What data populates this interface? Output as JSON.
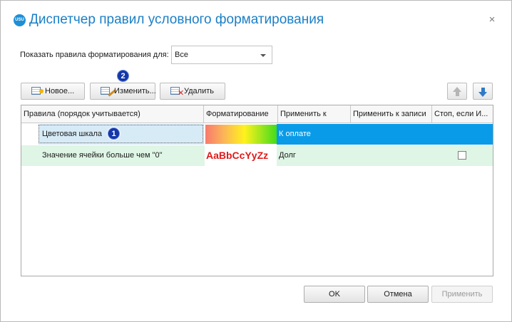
{
  "window": {
    "title": "Диспетчер правил условного форматирования",
    "app_icon_text": "USU",
    "close_symbol": "×"
  },
  "filter": {
    "label": "Показать правила форматирования для:",
    "selected": "Все"
  },
  "toolbar": {
    "new_label": "Новое...",
    "edit_label": "Изменить...",
    "delete_label": "Удалить"
  },
  "grid": {
    "columns": [
      "Правила (порядок учитывается)",
      "Форматирование",
      "Применить к",
      "Применить к записи",
      "Стоп, если И..."
    ],
    "rows": [
      {
        "rule": "Цветовая шкала",
        "format": "color-scale",
        "apply_to": "К оплате",
        "selected": true
      },
      {
        "rule": "Значение ячейки больше чем \"0\"",
        "format_sample": "AaBbCcYyZz",
        "apply_to": "Долг",
        "stop": false
      }
    ]
  },
  "annotations": {
    "badge1": "1",
    "badge2": "2"
  },
  "buttons": {
    "ok": "OK",
    "cancel": "Отмена",
    "apply": "Применить"
  },
  "colors": {
    "accent": "#1a7fc6",
    "selection": "#0a9be8",
    "row_highlight": "#dff5e5",
    "sample_text": "#e01a1a"
  }
}
